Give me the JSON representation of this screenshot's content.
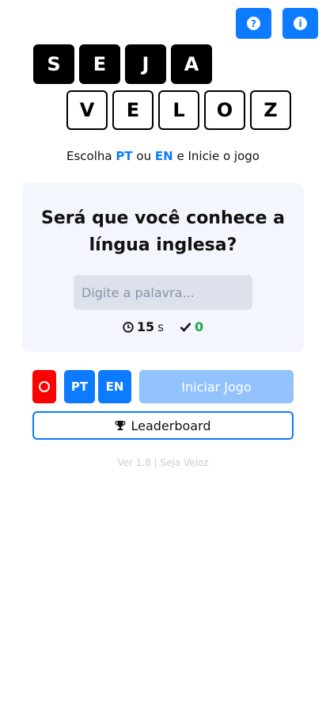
{
  "header": {
    "help_icon": "question-circle-icon",
    "info_icon": "info-circle-icon"
  },
  "logo": {
    "row1": [
      "S",
      "E",
      "J",
      "A"
    ],
    "row2": [
      "V",
      "E",
      "L",
      "O",
      "Z"
    ]
  },
  "subtitle": {
    "prefix": "Escolha",
    "pt": "PT",
    "middle": "ou",
    "en": "EN",
    "suffix": "e Inicie o jogo"
  },
  "card": {
    "title": "Será que você conhece a língua inglesa?",
    "input_placeholder": "Digite a palavra...",
    "input_value": "",
    "timer_value": "15",
    "timer_unit": "s",
    "score_value": "0"
  },
  "controls": {
    "pt_label": "PT",
    "en_label": "EN",
    "start_label": "Iniciar Jogo",
    "leaderboard_label": "Leaderboard"
  },
  "footer": {
    "text": "Ver 1.8 | Seja Veloz"
  },
  "colors": {
    "accent": "#0d7bff",
    "record": "#ff0000",
    "start_disabled": "#93c3fd",
    "success": "#1fa64a",
    "card_bg": "#f4f6fd"
  }
}
